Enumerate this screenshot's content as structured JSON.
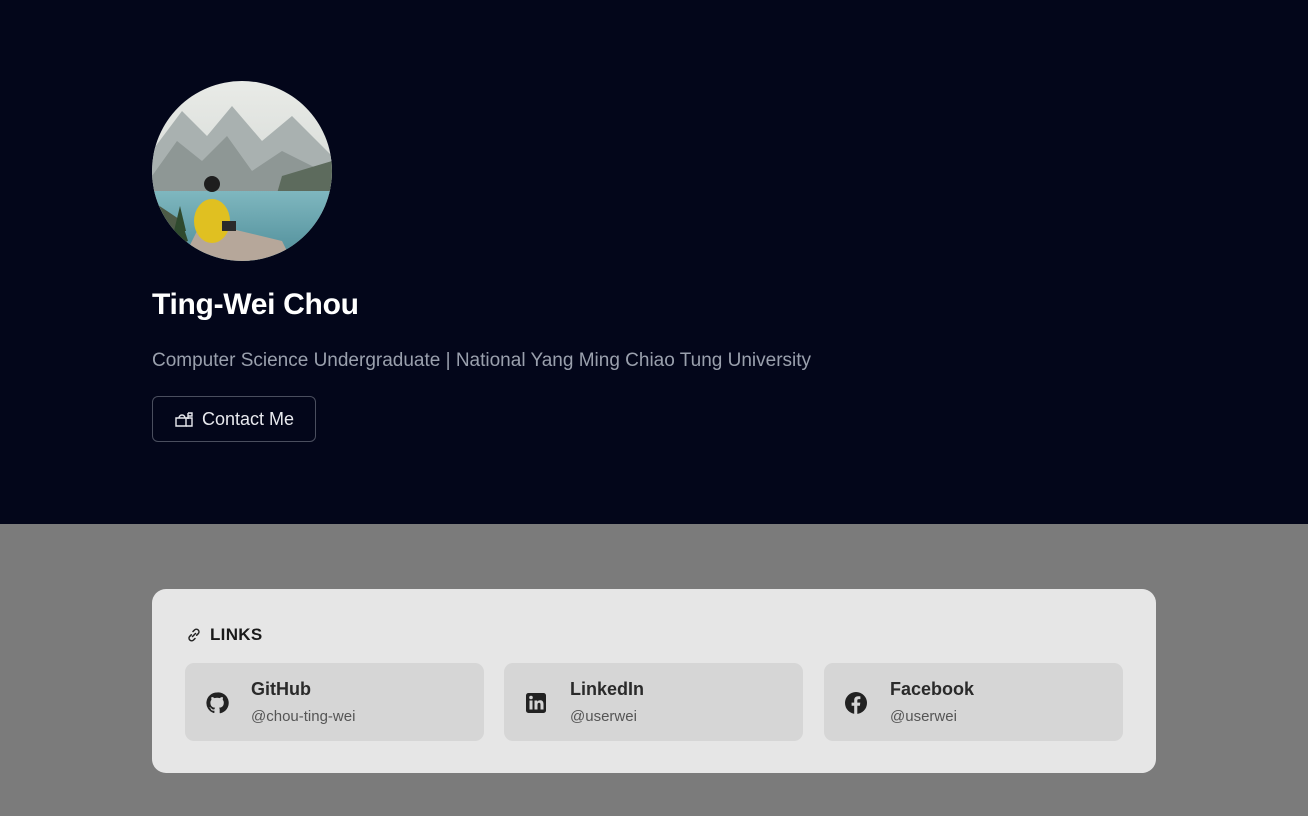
{
  "profile": {
    "name": "Ting-Wei Chou",
    "subtitle": "Computer Science Undergraduate | National Yang Ming Chiao Tung University",
    "contact_label": "Contact Me"
  },
  "links": {
    "heading": "LINKS",
    "items": [
      {
        "title": "GitHub",
        "handle": "@chou-ting-wei",
        "icon": "github-icon"
      },
      {
        "title": "LinkedIn",
        "handle": "@userwei",
        "icon": "linkedin-icon"
      },
      {
        "title": "Facebook",
        "handle": "@userwei",
        "icon": "facebook-icon"
      }
    ]
  },
  "colors": {
    "hero_bg": "#03061a",
    "page_bg": "#7b7b7b",
    "card_bg": "#e6e6e6",
    "tile_bg": "#d6d6d6"
  }
}
